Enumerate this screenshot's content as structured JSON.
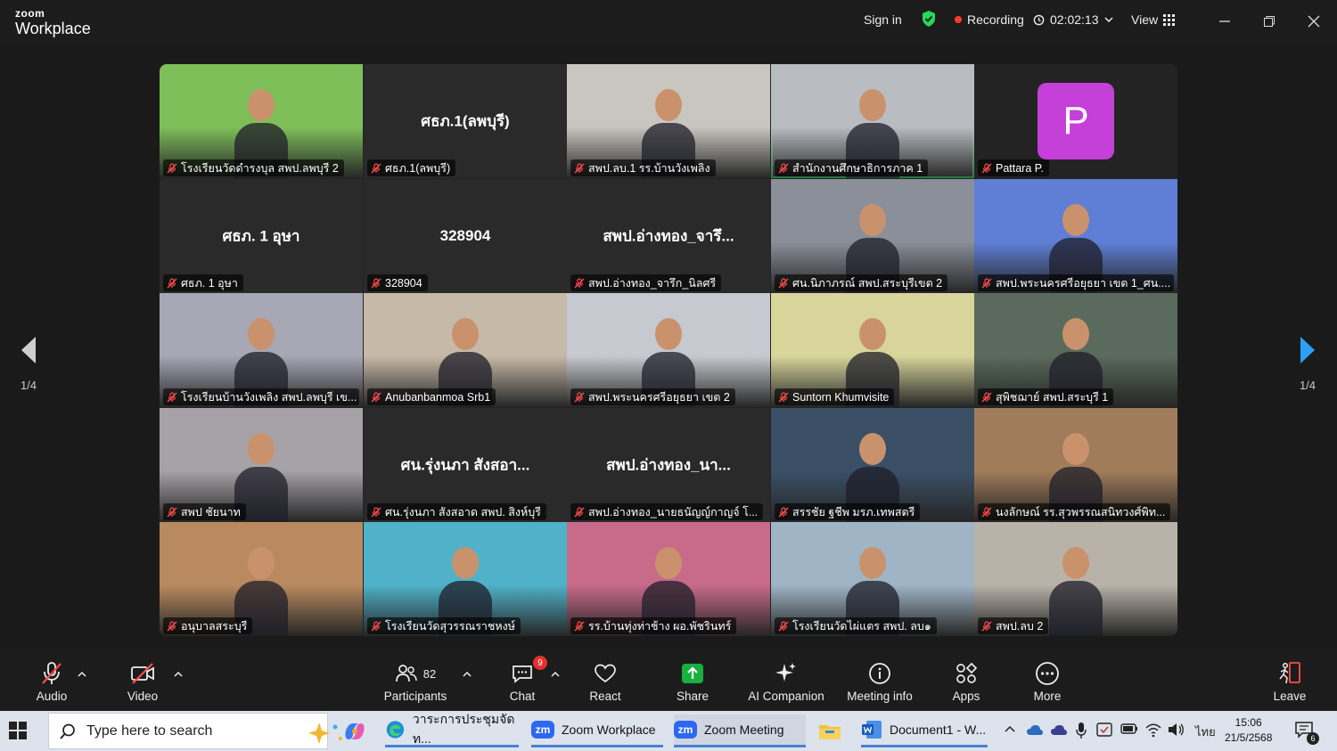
{
  "titlebar": {
    "brand_small": "zoom",
    "brand_big": "Workplace",
    "sign_in": "Sign in",
    "recording": "Recording",
    "timer": "02:02:13",
    "view": "View"
  },
  "nav": {
    "prev_page": "1/4",
    "next_page": "1/4"
  },
  "tiles": [
    {
      "label": "โรงเรียนวัดดำรงบุล สพป.ลพบุรี 2",
      "type": "video",
      "bg": "#7fbf5a"
    },
    {
      "label": "ศธภ.1(ลพบุรี)",
      "center": "ศธภ.1(ลพบุรี)",
      "type": "name"
    },
    {
      "label": "สพป.ลบ.1 รร.บ้านวังเพลิง",
      "type": "video",
      "bg": "#c9c6c0"
    },
    {
      "label": "สำนักงานศึกษาธิการภาค 1",
      "type": "video",
      "bg": "#b9bdc2",
      "active": true
    },
    {
      "label": "Pattara P.",
      "avatar": "P",
      "type": "avatar"
    },
    {
      "label": "ศธภ. 1 อุษา",
      "center": "ศธภ. 1 อุษา",
      "type": "name"
    },
    {
      "label": "328904",
      "center": "328904",
      "type": "name"
    },
    {
      "label": "สพป.อ่างทอง_จารึก_นิลศรี",
      "center": "สพป.อ่างทอง_จารึ...",
      "type": "name"
    },
    {
      "label": "ศน.นิภาภรณ์ สพป.สระบุรีเขต 2",
      "type": "video",
      "bg": "#8a8f99"
    },
    {
      "label": "สพป.พระนครศรีอยุธยา เขต 1_ศน....",
      "type": "video",
      "bg": "#5f7fd6"
    },
    {
      "label": "โรงเรียนบ้านวังเพลิง สพป.ลพบุรี เข...",
      "type": "video",
      "bg": "#a7a7b5"
    },
    {
      "label": "Anubanbanmoa Srb1",
      "type": "video",
      "bg": "#c7b9a7"
    },
    {
      "label": "สพป.พระนครศรีอยุธยา เขต 2",
      "type": "video",
      "bg": "#c6c9cf"
    },
    {
      "label": "Suntorn Khumvisite",
      "type": "video",
      "bg": "#d8d59b"
    },
    {
      "label": "สุพิชฌาย์ สพป.สระบุรี 1",
      "type": "video",
      "bg": "#5a6a5c"
    },
    {
      "label": "สพป ชัยนาท",
      "type": "video",
      "bg": "#a6a2a8"
    },
    {
      "label": "ศน.รุ่งนภา สังสอาด สพป. สิงห์บุรี",
      "center": "ศน.รุ่งนภา สังสอา...",
      "type": "name"
    },
    {
      "label": "สพป.อ่างทอง_นายธนัญญ์กาญจ์ โ...",
      "center": "สพป.อ่างทอง_นา...",
      "type": "name"
    },
    {
      "label": "สรรชัย ฐชีพ มรภ.เทพสตรี",
      "type": "video",
      "bg": "#3a4f66"
    },
    {
      "label": "นงลักษณ์ รร.สุวพรรณสนิทวงศ์พิท...",
      "type": "video",
      "bg": "#a07c5a"
    },
    {
      "label": "อนุบาลสระบุรี",
      "type": "video",
      "bg": "#b98a5f"
    },
    {
      "label": "โรงเรียนวัดสุวรรณราชหงษ์",
      "type": "video",
      "bg": "#4fb2c9"
    },
    {
      "label": "รร.บ้านทุ่งท่าช้าง ผอ.พัชรินทร์",
      "type": "video",
      "bg": "#c86a8a"
    },
    {
      "label": "โรงเรียนวัดไผ่แตร สพป. ลบ๑",
      "type": "video",
      "bg": "#9fb5c6"
    },
    {
      "label": "สพป.ลบ 2",
      "type": "video",
      "bg": "#b9b2a8"
    }
  ],
  "toolbar": {
    "audio": "Audio",
    "video": "Video",
    "participants": "Participants",
    "participants_count": "82",
    "chat": "Chat",
    "chat_badge": "9",
    "react": "React",
    "share": "Share",
    "ai_companion": "AI Companion",
    "meeting_info": "Meeting info",
    "apps": "Apps",
    "more": "More",
    "leave": "Leave"
  },
  "taskbar": {
    "search_placeholder": "Type here to search",
    "app_edge": "วาระการประชุมจัดท...",
    "app_zoom_workplace": "Zoom Workplace",
    "app_zoom_meeting": "Zoom Meeting",
    "app_word": "Document1 - W...",
    "zm_icon": "zm",
    "lang": "ไทย",
    "time": "15:06",
    "date": "21/5/2568",
    "notif_count": "6"
  },
  "colors": {
    "accent_green": "#23d959",
    "record_red": "#ff3b30",
    "share_green": "#19b03e",
    "avatar_purple": "#c53fd9",
    "nav_blue": "#2aa0f5"
  }
}
